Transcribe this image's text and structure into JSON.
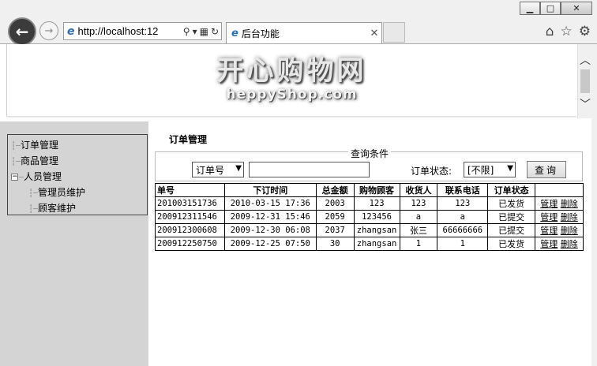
{
  "browser": {
    "address": "http://localhost:12",
    "tab_title": "后台功能",
    "controls": {
      "minimize": "▁",
      "maximize": "□",
      "close": "✕"
    }
  },
  "header": {
    "title": "开心购物网",
    "subtitle": "heppyShop.com"
  },
  "tree": {
    "items": [
      {
        "label": "订单管理"
      },
      {
        "label": "商品管理"
      },
      {
        "label": "人员管理",
        "toggle": "−"
      },
      {
        "label": "管理员维护"
      },
      {
        "label": "顾客维护"
      }
    ]
  },
  "main": {
    "section_title": "订单管理",
    "query": {
      "legend": "查询条件",
      "field_select": "订单号",
      "text_value": "",
      "status_label": "订单状态:",
      "status_select": "[不限]",
      "button": "查询"
    },
    "table": {
      "headers": [
        "单号",
        "下订时间",
        "总金额",
        "购物顾客",
        "收货人",
        "联系电话",
        "订单状态",
        ""
      ],
      "rows": [
        {
          "id": "201003151736",
          "time": "2010-03-15 17:36",
          "amount": "2003",
          "customer": "123",
          "receiver": "123",
          "phone": "123",
          "status": "已发货",
          "manage": "管理",
          "delete": "删除"
        },
        {
          "id": "200912311546",
          "time": "2009-12-31 15:46",
          "amount": "2059",
          "customer": "123456",
          "receiver": "a",
          "phone": "a",
          "status": "已提交",
          "manage": "管理",
          "delete": "删除"
        },
        {
          "id": "200912300608",
          "time": "2009-12-30 06:08",
          "amount": "2037",
          "customer": "zhangsan",
          "receiver": "张三",
          "phone": "66666666",
          "status": "已提交",
          "manage": "管理",
          "delete": "删除"
        },
        {
          "id": "200912250750",
          "time": "2009-12-25 07:50",
          "amount": "30",
          "customer": "zhangsan",
          "receiver": "1",
          "phone": "1",
          "status": "已发货",
          "manage": "管理",
          "delete": "删除"
        }
      ]
    }
  }
}
